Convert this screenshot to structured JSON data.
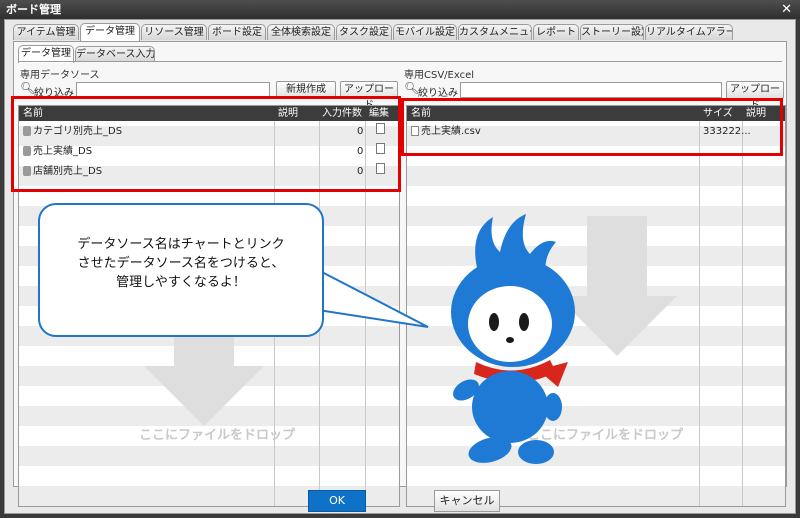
{
  "window": {
    "title": "ボード管理",
    "close_icon": "✕"
  },
  "main_tabs": [
    {
      "label": "アイテム管理",
      "active": false
    },
    {
      "label": "データ管理",
      "active": true
    },
    {
      "label": "リソース管理",
      "active": false
    },
    {
      "label": "ボード設定",
      "active": false
    },
    {
      "label": "全体検索設定",
      "active": false
    },
    {
      "label": "タスク設定",
      "active": false
    },
    {
      "label": "モバイル設定",
      "active": false
    },
    {
      "label": "カスタムメニュー",
      "active": false
    },
    {
      "label": "レポート",
      "active": false
    },
    {
      "label": "ストーリー設定",
      "active": false
    },
    {
      "label": "リアルタイムアラート",
      "active": false
    }
  ],
  "sub_tabs": [
    {
      "label": "データ管理",
      "active": true
    },
    {
      "label": "データベース入力",
      "active": false
    }
  ],
  "left": {
    "section_title": "専用データソース",
    "filter_label": "絞り込み",
    "filter_value": "",
    "new_button": "新規作成",
    "upload_button": "アップロード",
    "columns": [
      "名前",
      "説明",
      "入力件数",
      "編集"
    ],
    "rows": [
      {
        "name": "カテゴリ別売上_DS",
        "desc": "",
        "count": "0"
      },
      {
        "name": "売上実績_DS",
        "desc": "",
        "count": "0"
      },
      {
        "name": "店舗別売上_DS",
        "desc": "",
        "count": "0"
      }
    ],
    "drop_text": "ここにファイルをドロップ"
  },
  "right": {
    "section_title": "専用CSV/Excel",
    "filter_label": "絞り込み",
    "filter_value": "",
    "upload_button": "アップロード",
    "columns": [
      "名前",
      "サイズ",
      "説明"
    ],
    "rows": [
      {
        "name": "売上実績.csv",
        "size": "333222...",
        "desc": ""
      }
    ],
    "drop_text": "ここにファイルをドロップ"
  },
  "bubble": {
    "line1": "データソース名はチャートとリンク",
    "line2": "させたデータソース名をつけると、",
    "line3": "管理しやすくなるよ！"
  },
  "footer": {
    "ok": "OK",
    "cancel": "キャンセル"
  },
  "colors": {
    "accent_red": "#e30000",
    "ok_blue": "#0f72c9",
    "mascot_blue": "#1f7ad6"
  }
}
